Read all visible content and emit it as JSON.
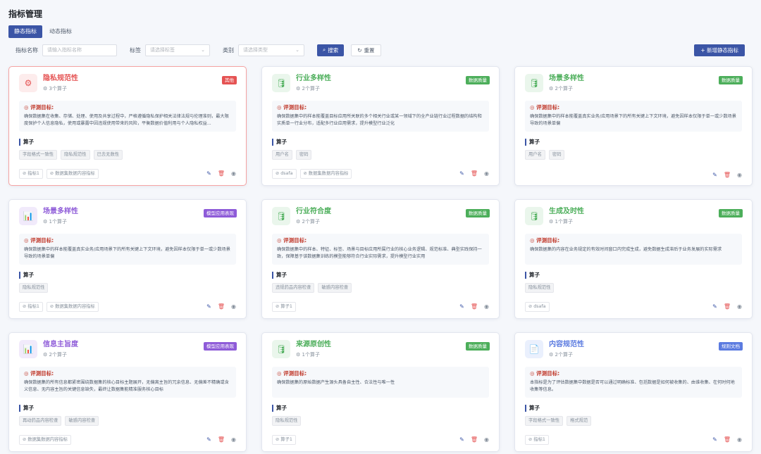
{
  "page": {
    "title": "指标管理"
  },
  "tabs": [
    {
      "label": "静态指标",
      "active": true
    },
    {
      "label": "动态指标",
      "active": false
    }
  ],
  "filters": {
    "name_label": "指标名称",
    "name_placeholder": "请输入指标名称",
    "tag_label": "标签",
    "tag_placeholder": "请选择标签",
    "category_label": "类别",
    "category_placeholder": "请选择类型",
    "search_label": "搜索",
    "reset_label": "重置"
  },
  "add_button_label": "+ 新增静态指标",
  "colors": {
    "primary": "#3b55a6",
    "red": "#e55353",
    "green": "#4cae5a",
    "purple": "#8e5bd8",
    "blue": "#5b7be0"
  },
  "goal_heading": "评测目标:",
  "operator_heading": "算子",
  "cards": [
    {
      "name": "隐私规范性",
      "count": "3个算子",
      "badge": "其他",
      "icon": "gear-icon",
      "theme": "red",
      "goal": "确保数据集在收集、存储、处理、使用及共享过程中，严格遵循隐私保护相关法律法规与伦理准则，最大限度保护个人信息隐私，使用或暴露中因违规使用带来的风险，平衡数据价值利用与个人隐私权益...",
      "operators": [
        "字段格式一致性",
        "隐私规范性",
        "已去无数性"
      ],
      "tags": [
        "指标1",
        "数据集数据内容指标"
      ],
      "selected": true
    },
    {
      "name": "行业多样性",
      "count": "2个算子",
      "badge": "数据质量",
      "icon": "database-icon",
      "theme": "green",
      "goal": "确保数据集中的样本能覆盖目标应用所关联的多个相关行业或某一领域下的全产业链行业过程数据的结构和实质单一行业分布，适配多行业应用需求，提升模型行业泛化",
      "operators": [
        "用户名",
        "密码"
      ],
      "tags": [
        "dsafa",
        "数据集数据内容指标"
      ],
      "selected": false
    },
    {
      "name": "场景多样性",
      "count": "2个算子",
      "badge": "数据质量",
      "icon": "database-icon",
      "theme": "green",
      "goal": "确保数据集中的样本能覆盖真实业务/应用场景下的所有关键上下文环境，避免因样本仅限于单一或少数场景导致的场景单偏",
      "operators": [
        "用户名",
        "密码"
      ],
      "tags": [],
      "selected": false
    },
    {
      "name": "场景多样性",
      "count": "1个算子",
      "badge": "模型应用表现",
      "icon": "chart-icon",
      "theme": "purple",
      "goal": "确保数据集中的样本能覆盖真实业务/应用场景下的所有关键上下文环境，避免因样本仅限于单一或少数场景导致的场景单偏",
      "operators": [
        "隐私规范性"
      ],
      "tags": [
        "指标1",
        "数据集数据内容指标"
      ],
      "selected": false
    },
    {
      "name": "行业符合度",
      "count": "2个算子",
      "badge": "数据质量",
      "icon": "database-icon",
      "theme": "green",
      "goal": "确保数据集中的样本、特征、标签、场景与目标应用所属行业的核心业务逻辑、规范标准、典型实践保持一致，保障基于该数据集训练的模型能够符合行业实际需求，提升模型行业实用",
      "operators": [
        "违规药品内容检查",
        "敏感内容检查"
      ],
      "tags": [
        "算子1"
      ],
      "selected": false
    },
    {
      "name": "生成及时性",
      "count": "1个算子",
      "badge": "数据质量",
      "icon": "database-icon",
      "theme": "green",
      "goal": "确保数据集的内容在业务规定的有效时间窗口内完成生成，避免数据生成滞后于业务发展的实际需求",
      "operators": [
        "隐私规范性"
      ],
      "tags": [
        "dsafa"
      ],
      "selected": false
    },
    {
      "name": "信息主旨度",
      "count": "2个算子",
      "badge": "模型应用表现",
      "icon": "chart-icon",
      "theme": "purple",
      "goal": "确保数据集的所有信息都紧密围绕数据集的核心目标主题展开，无偏离主旨的冗余信息、无偏差不精确或含义信息、无内容主旨的关键信息缺失，最终让数据集能精准服务核心目标",
      "operators": [
        "再动药品内容检查",
        "敏感内容检查"
      ],
      "tags": [
        "数据集数据内容指标"
      ],
      "selected": false
    },
    {
      "name": "来源原创性",
      "count": "1个算子",
      "badge": "数据质量",
      "icon": "database-icon",
      "theme": "green",
      "goal": "确保数据集的原始数据产生源头具备自主性、合法性与唯一性",
      "operators": [
        "隐私规范性"
      ],
      "tags": [
        "算子1"
      ],
      "selected": false
    },
    {
      "name": "内容规范性",
      "count": "2个算子",
      "badge": "规则文档",
      "icon": "document-icon",
      "theme": "blue",
      "goal": "本指标是为了评估数据集中数据是否可以通过明确标准、包括数据是如何被收集的、由谁收集、在何时何地收集等信息。",
      "operators": [
        "字段格式一致性",
        "格式规范"
      ],
      "tags": [
        "指标1"
      ],
      "selected": false
    }
  ]
}
